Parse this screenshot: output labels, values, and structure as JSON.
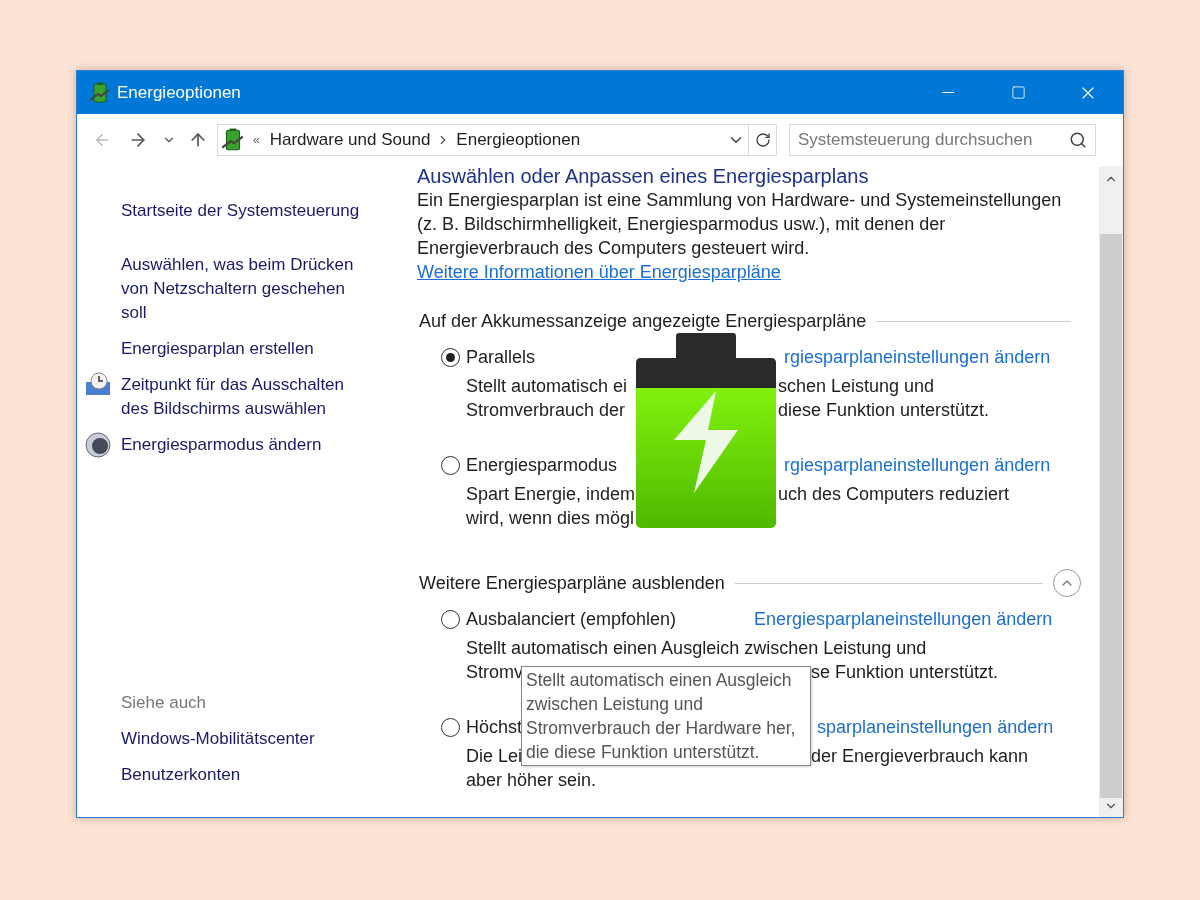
{
  "window": {
    "title": "Energieoptionen"
  },
  "nav": {
    "overflow": "«",
    "breadcrumb": [
      "Hardware und Sound",
      "Energieoptionen"
    ],
    "search": {
      "placeholder": "Systemsteuerung durchsuchen"
    }
  },
  "sidebar": {
    "items": [
      {
        "label": "Startseite der Systemsteuerung",
        "kind": "link"
      },
      {
        "label": "Auswählen, was beim Drücken von Netzschaltern geschehen soll",
        "kind": "link"
      },
      {
        "label": "Energiesparplan erstellen",
        "kind": "link"
      },
      {
        "label": "Zeitpunkt für das Ausschalten des Bildschirms auswählen",
        "kind": "clock"
      },
      {
        "label": "Energiesparmodus ändern",
        "kind": "moon"
      }
    ],
    "see_also": {
      "title": "Siehe auch",
      "items": [
        "Windows-Mobilitätscenter",
        "Benutzerkonten"
      ]
    }
  },
  "main": {
    "heading": "Auswählen oder Anpassen eines Energiesparplans",
    "intro": "Ein Energiesparplan ist eine Sammlung von Hardware- und Systemeinstellungen (z. B. Bildschirmhelligkeit, Energiesparmodus usw.), mit denen der Energieverbrauch des Computers gesteuert wird.",
    "intro_link": "Weitere Informationen über Energiesparpläne",
    "groups": [
      {
        "title": "Auf der Akkumessanzeige angezeigte Energiesparpläne",
        "plans": [
          {
            "name": "Parallels",
            "selected": true,
            "link": "rgiesparplaneinstellungen ändern",
            "desc": [
              [
                "Stellt automatisch ei",
                "schen Leistung und"
              ],
              [
                "Stromverbrauch der",
                "diese Funktion unterstützt."
              ]
            ]
          },
          {
            "name": "Energiesparmodus",
            "selected": false,
            "link": "rgiesparplaneinstellungen ändern",
            "desc": [
              [
                "Spart Energie, indem",
                "uch des Computers reduziert"
              ],
              [
                "wird, wenn dies mögl"
              ]
            ]
          }
        ]
      },
      {
        "title": "Weitere Energiesparpläne ausblenden",
        "expanded": true,
        "plans": [
          {
            "name": "Ausbalanciert (empfohlen)",
            "selected": false,
            "link": "Energiesparplaneinstellungen ändern",
            "desc": [
              [
                "Stellt automatisch einen Ausgleich zwischen Leistung und"
              ],
              [
                "Stromv",
                "se Funktion unterstützt."
              ]
            ]
          },
          {
            "name": "Höchst",
            "selected": false,
            "link": "sparplaneinstellungen ändern",
            "desc": [
              [
                "Die Lei",
                "der Energieverbrauch kann"
              ],
              [
                "aber höher sein."
              ]
            ]
          }
        ]
      }
    ]
  },
  "tooltip": {
    "text": "Stellt automatisch einen Ausgleich zwischen Leistung und Stromverbrauch der Hardware her, die diese Funktion unterstützt."
  }
}
